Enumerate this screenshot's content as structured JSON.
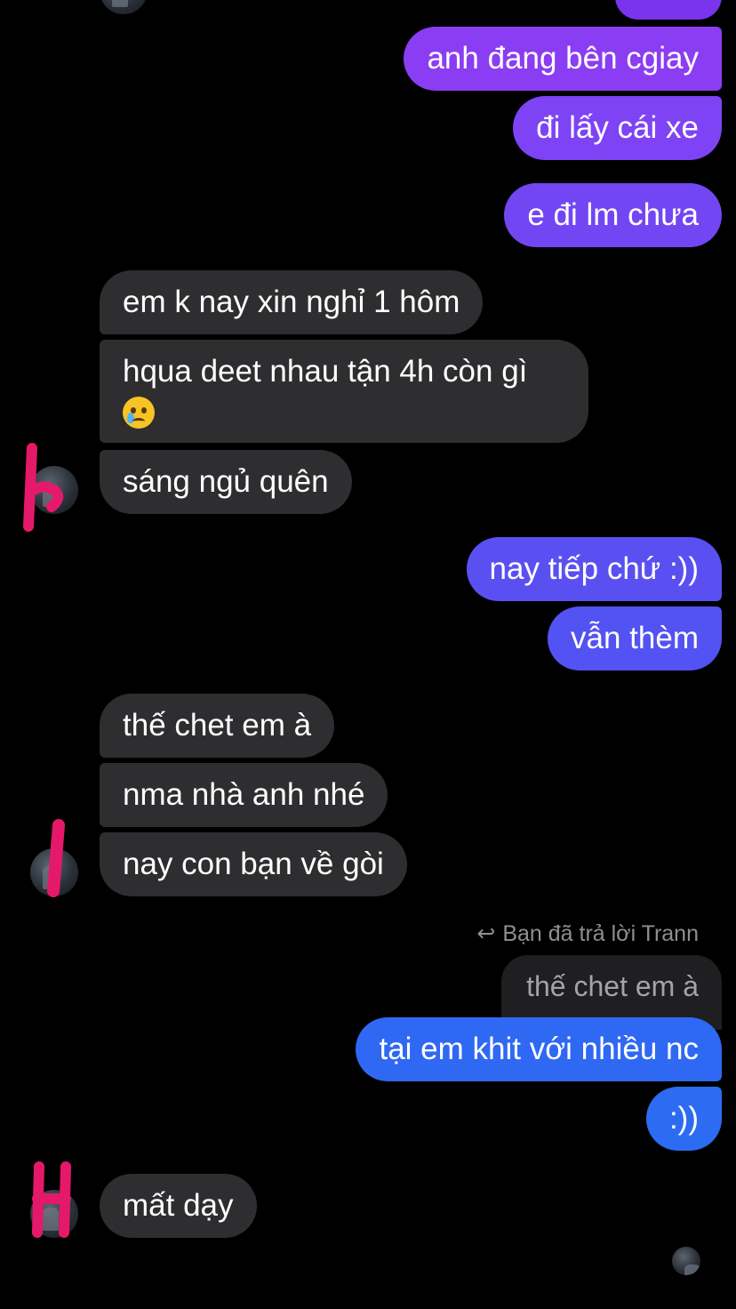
{
  "messages": [
    {
      "text": "anh đang bên cgiay"
    },
    {
      "text": "đi lấy cái xe"
    },
    {
      "text": "e đi lm chưa"
    },
    {
      "text": "em k nay xin nghỉ 1 hôm"
    },
    {
      "text": "hqua deet nhau tận 4h còn gì"
    },
    {
      "text": "sáng ngủ quên"
    },
    {
      "text": "nay tiếp chứ :))"
    },
    {
      "text": "vẫn thèm"
    },
    {
      "text": "thế chet em à"
    },
    {
      "text": "nma nhà anh nhé"
    },
    {
      "text": "nay con bạn về gòi"
    },
    {
      "text": "tại em khit với nhiều nc"
    },
    {
      "text": ":))"
    },
    {
      "text": "mất dạy"
    }
  ],
  "reply": {
    "label": "Bạn đã trả lời Trann",
    "arrow": "↩",
    "quoted_text": "thế chet em à"
  },
  "emoji": {
    "name": "face-holding-back-tears-icon"
  },
  "colors": {
    "incoming": "#2e2e30",
    "outgoing_purple": "#7b3cf2",
    "outgoing_blue": "#2f64f2",
    "scribble": "#e5196a"
  }
}
